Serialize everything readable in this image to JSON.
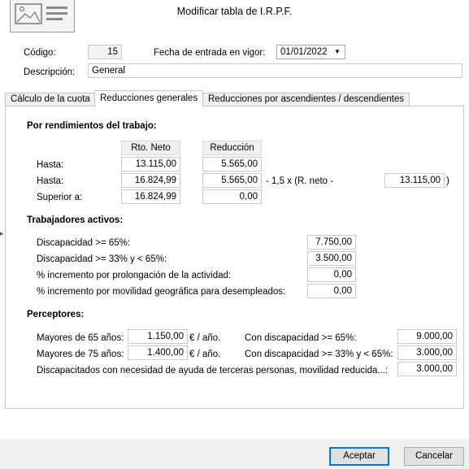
{
  "window": {
    "title": "Modificar tabla de I.R.P.F."
  },
  "header": {
    "codigo_label": "Código:",
    "codigo_value": "15",
    "fecha_label": "Fecha de entrada en vigor:",
    "fecha_value": "01/01/2022",
    "descripcion_label": "Descripción:",
    "descripcion_value": "General"
  },
  "tabs": [
    {
      "label": "Cálculo de la cuota",
      "active": false
    },
    {
      "label": "Reducciones generales",
      "active": true
    },
    {
      "label": "Reducciones por ascendientes / descendientes",
      "active": false
    }
  ],
  "rendimientos": {
    "heading": "Por rendimientos del trabajo:",
    "col_rto_neto": "Rto. Neto",
    "col_reduccion": "Reducción",
    "rows": [
      {
        "label": "Hasta:",
        "rto_neto": "13.115,00",
        "reduccion": "5.565,00"
      },
      {
        "label": "Hasta:",
        "rto_neto": "16.824,99",
        "reduccion": "5.565,00"
      },
      {
        "label": "Superior a:",
        "rto_neto": "16.824,99",
        "reduccion": "0,00"
      }
    ],
    "formula_text": "- 1,5 x (R. neto -",
    "formula_value": "13.115,00",
    "formula_close": ")"
  },
  "trabajadores": {
    "heading": "Trabajadores activos:",
    "rows": [
      {
        "label": "Discapacidad >= 65%:",
        "value": "7.750,00"
      },
      {
        "label": "Discapacidad >= 33% y < 65%:",
        "value": "3.500,00"
      },
      {
        "label": "% incremento por prolongación de la actividad:",
        "value": "0,00"
      },
      {
        "label": "% incremento por movilidad geográfica para desempleados:",
        "value": "0,00"
      }
    ]
  },
  "perceptores": {
    "heading": "Perceptores:",
    "mayores65_label": "Mayores de 65 años:",
    "mayores65_value": "1.150,00",
    "mayores75_label": "Mayores de 75 años:",
    "mayores75_value": "1.400,00",
    "unit": "€ / año.",
    "disc65_label": "Con discapacidad >= 65%:",
    "disc65_value": "9.000,00",
    "disc33_label": "Con discapacidad >= 33% y < 65%:",
    "disc33_value": "3.000,00",
    "ayuda_label": "Discapacitados con necesidad de ayuda de terceras personas, movilidad reducida...:",
    "ayuda_value": "3.000,00"
  },
  "buttons": {
    "accept": "Aceptar",
    "cancel": "Cancelar"
  },
  "icons": {
    "header": "image-placeholder-icon",
    "dropdown": "chevron-down-icon",
    "edge": "chevron-right-icon"
  }
}
